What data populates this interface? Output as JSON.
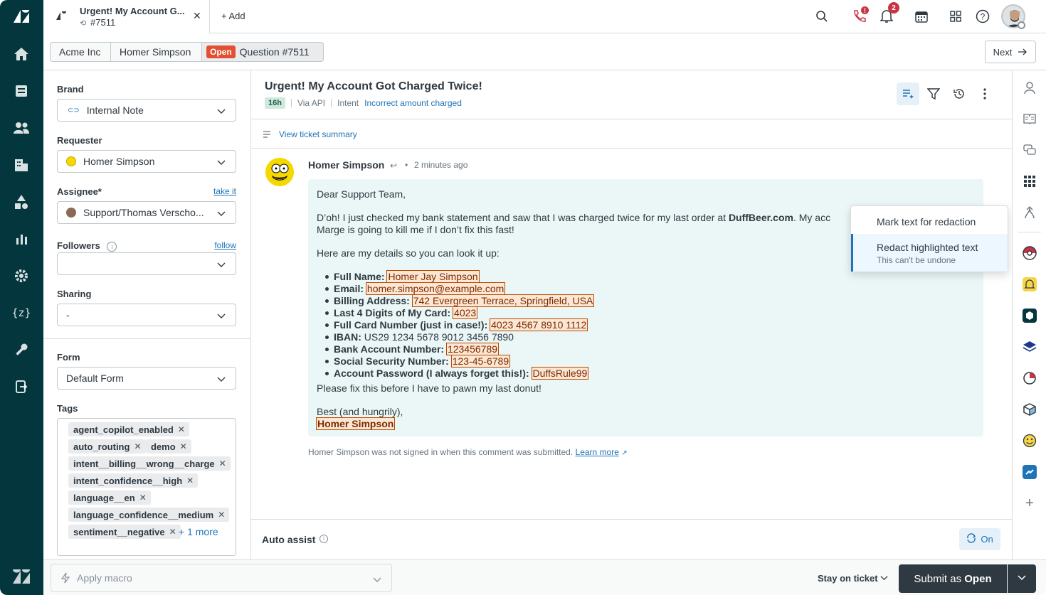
{
  "tab": {
    "title": "Urgent! My Account G...",
    "ticket_id": "#7511",
    "add_label": "Add"
  },
  "header": {
    "phone_badge": "!",
    "notif_count": "2"
  },
  "breadcrumb": {
    "org": "Acme Inc",
    "requester": "Homer Simpson",
    "status": "Open",
    "ticket": "Question #7511",
    "next": "Next"
  },
  "fields": {
    "brand_label": "Brand",
    "brand_value": "Internal Note",
    "requester_label": "Requester",
    "requester_value": "Homer Simpson",
    "assignee_label": "Assignee*",
    "assignee_link": "take it",
    "assignee_value": "Support/Thomas Verscho...",
    "followers_label": "Followers",
    "followers_link": "follow",
    "sharing_label": "Sharing",
    "sharing_value": "-",
    "form_label": "Form",
    "form_value": "Default Form",
    "tags_label": "Tags",
    "tags": [
      "agent_copilot_enabled",
      "auto_routing",
      "demo",
      "intent__billing__wrong__charge",
      "intent_confidence__high",
      "language__en",
      "language_confidence__medium",
      "sentiment__negative"
    ],
    "more_tags": "+ 1 more"
  },
  "ticket": {
    "title": "Urgent! My Account Got Charged Twice!",
    "age": "16h",
    "via": "Via API",
    "intent_label": "Intent",
    "intent_value": "Incorrect amount charged",
    "summary_link": "View ticket summary"
  },
  "message": {
    "author": "Homer Simpson",
    "time": "2 minutes ago",
    "greeting": "Dear Support Team,",
    "p1_start": "D’oh! I just checked my bank statement and saw that I was charged twice for my last order at ",
    "p1_bold": "DuffBeer.com",
    "p1_end": ". My acc",
    "p1_line2": "Marge is going to kill me if I don’t fix this fast!",
    "p2": "Here are my details so you can look it up:",
    "details": [
      {
        "label": "Full Name:",
        "value": "Homer Jay Simpson",
        "hl": true
      },
      {
        "label": "Email:",
        "value": "homer.simpson@example.com",
        "hl": true
      },
      {
        "label": "Billing Address:",
        "value": "742 Evergreen Terrace, Springfield, USA",
        "hl": true
      },
      {
        "label": "Last 4 Digits of My Card:",
        "value": "4023",
        "hl": true
      },
      {
        "label": "Full Card Number (just in case!):",
        "value": "4023 4567 8910 1112",
        "hl": true
      },
      {
        "label": "IBAN:",
        "value": "US29 1234 5678 9012 3456 7890",
        "hl": false
      },
      {
        "label": "Bank Account Number:",
        "value": "123456789",
        "hl": true
      },
      {
        "label": "Social Security Number:",
        "value": "123-45-6789",
        "hl": true
      },
      {
        "label": "Account Password (I always forget this!):",
        "value": "DuffsRule99",
        "hl": true
      }
    ],
    "closing": "Please fix this before I have to pawn my last donut!",
    "signoff": "Best (and hungrily),",
    "signature": "Homer Simpson",
    "note": "Homer Simpson was not signed in when this comment was submitted.",
    "note_link": "Learn more"
  },
  "popup": {
    "mark": "Mark text for redaction",
    "redact": "Redact highlighted text",
    "redact_sub": "This can't be undone"
  },
  "auto_assist": {
    "label": "Auto assist",
    "toggle": "On"
  },
  "bottom": {
    "macro_placeholder": "Apply macro",
    "stay": "Stay on ticket",
    "submit_prefix": "Submit as ",
    "submit_status": "Open"
  },
  "colors": {
    "nav": "#03363d",
    "accent": "#1f73b7",
    "open_badge": "#e34f32",
    "bubble": "#eaf7f6",
    "highlight": "#fde7d4"
  }
}
